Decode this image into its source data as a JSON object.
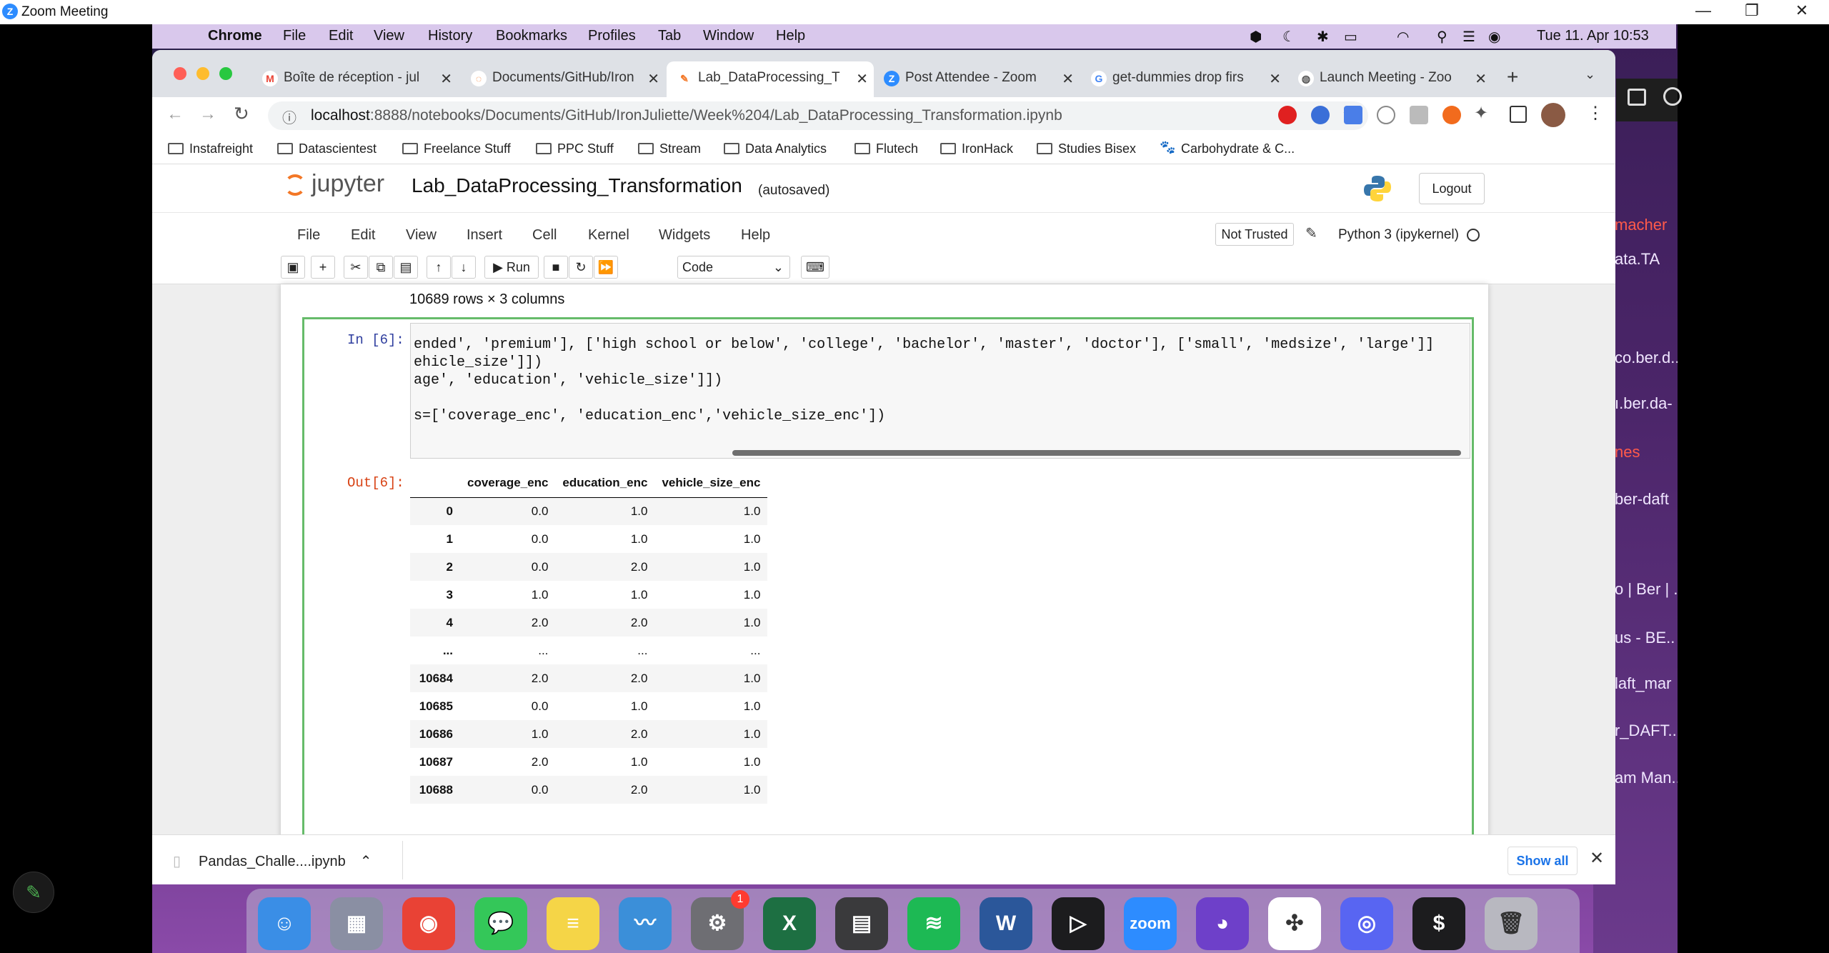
{
  "zoom": {
    "title": "Zoom Meeting",
    "logo": "Z",
    "minimize": "—",
    "restore": "❐",
    "close": "✕"
  },
  "menubar": {
    "items": [
      "Chrome",
      "File",
      "Edit",
      "View",
      "History",
      "Bookmarks",
      "Profiles",
      "Tab",
      "Window",
      "Help"
    ],
    "datetime": "Tue 11. Apr  10:53"
  },
  "tabs": [
    {
      "label": "Boîte de réception - jul",
      "icon": "M"
    },
    {
      "label": "Documents/GitHub/Iron",
      "icon": "◌"
    },
    {
      "label": "Lab_DataProcessing_T",
      "icon": "✎"
    },
    {
      "label": "Post Attendee - Zoom",
      "icon": "Z"
    },
    {
      "label": "get-dummies drop firs",
      "icon": "G"
    },
    {
      "label": "Launch Meeting - Zoo",
      "icon": "◍"
    }
  ],
  "address": {
    "host": "localhost",
    "path": ":8888/notebooks/Documents/GitHub/IronJuliette/Week%204/Lab_DataProcessing_Transformation.ipynb"
  },
  "bookmarks": [
    "Instafreight",
    "Datascientest",
    "Freelance Stuff",
    "PPC Stuff",
    "Stream",
    "Data Analytics",
    "Flutech",
    "IronHack",
    "Studies Bisex",
    "Carbohydrate & C..."
  ],
  "jupyter": {
    "logo_text": "jupyter",
    "notebook_name": "Lab_DataProcessing_Transformation",
    "autosave": "(autosaved)",
    "logout": "Logout",
    "menu": [
      "File",
      "Edit",
      "View",
      "Insert",
      "Cell",
      "Kernel",
      "Widgets",
      "Help"
    ],
    "not_trusted": "Not Trusted",
    "kernel": "Python 3 (ipykernel)",
    "run_label": "Run",
    "cell_type": "Code"
  },
  "notebook": {
    "rows_info": "10689 rows × 3 columns",
    "in_prompt": "In [6]:",
    "out_prompt": "Out[6]:",
    "code_lines": [
      "ended', 'premium'], ['high school or below', 'college', 'bachelor', 'master', 'doctor'], ['small', 'medsize', 'large']]",
      "ehicle_size']])",
      "age', 'education', 'vehicle_size']])",
      "",
      "s=['coverage_enc', 'education_enc','vehicle_size_enc'])"
    ],
    "table": {
      "columns": [
        "coverage_enc",
        "education_enc",
        "vehicle_size_enc"
      ],
      "rows": [
        {
          "index": "0",
          "values": [
            "0.0",
            "1.0",
            "1.0"
          ]
        },
        {
          "index": "1",
          "values": [
            "0.0",
            "1.0",
            "1.0"
          ]
        },
        {
          "index": "2",
          "values": [
            "0.0",
            "2.0",
            "1.0"
          ]
        },
        {
          "index": "3",
          "values": [
            "1.0",
            "1.0",
            "1.0"
          ]
        },
        {
          "index": "4",
          "values": [
            "2.0",
            "2.0",
            "1.0"
          ]
        },
        {
          "index": "...",
          "values": [
            "...",
            "...",
            "..."
          ]
        },
        {
          "index": "10684",
          "values": [
            "2.0",
            "2.0",
            "1.0"
          ]
        },
        {
          "index": "10685",
          "values": [
            "0.0",
            "1.0",
            "1.0"
          ]
        },
        {
          "index": "10686",
          "values": [
            "1.0",
            "2.0",
            "1.0"
          ]
        },
        {
          "index": "10687",
          "values": [
            "2.0",
            "1.0",
            "1.0"
          ]
        },
        {
          "index": "10688",
          "values": [
            "0.0",
            "2.0",
            "1.0"
          ]
        }
      ]
    }
  },
  "download": {
    "file": "Pandas_Challe....ipynb",
    "show_all": "Show all"
  },
  "desktop_side": {
    "items": [
      {
        "text": "macher",
        "red": true
      },
      {
        "text": "ata.TA",
        "red": false
      },
      {
        "text": "co.ber.d..",
        "red": false
      },
      {
        "text": "ı.ber.da-",
        "red": false
      },
      {
        "text": "nes",
        "red": true
      },
      {
        "text": "ber-daft",
        "red": false
      },
      {
        "text": "o | Ber | ..",
        "red": false
      },
      {
        "text": "us - BE..",
        "red": false
      },
      {
        "text": "laft_mar",
        "red": false
      },
      {
        "text": "r_DAFT..",
        "red": false
      },
      {
        "text": "am Man..",
        "red": false
      }
    ]
  },
  "dock": {
    "apps": [
      {
        "name": "finder",
        "glyph": "☺",
        "color": "#3a8ee6"
      },
      {
        "name": "launchpad",
        "glyph": "▦",
        "color": "#8a8fa3"
      },
      {
        "name": "chrome",
        "glyph": "◉",
        "color": "#e94235"
      },
      {
        "name": "messages",
        "glyph": "💬",
        "color": "#34c759"
      },
      {
        "name": "notes",
        "glyph": "≡",
        "color": "#f5d547"
      },
      {
        "name": "mustache-app",
        "glyph": "〰",
        "color": "#3b8fd9"
      },
      {
        "name": "system-settings",
        "glyph": "⚙",
        "color": "#6e6e73"
      },
      {
        "name": "excel",
        "glyph": "X",
        "color": "#1d6f42"
      },
      {
        "name": "calculator",
        "glyph": "▤",
        "color": "#3a3a3c"
      },
      {
        "name": "spotify",
        "glyph": "≋",
        "color": "#1db954"
      },
      {
        "name": "word",
        "glyph": "W",
        "color": "#2b579a"
      },
      {
        "name": "cursor-app",
        "glyph": "▷",
        "color": "#1c1c1e"
      },
      {
        "name": "zoom",
        "glyph": "zoom",
        "color": "#2d8cff"
      },
      {
        "name": "github-desktop",
        "glyph": "◕",
        "color": "#6e40c9"
      },
      {
        "name": "slack",
        "glyph": "✣",
        "color": "#ffffff"
      },
      {
        "name": "discord",
        "glyph": "◎",
        "color": "#5865f2"
      },
      {
        "name": "terminal",
        "glyph": "$",
        "color": "#1c1c1e"
      },
      {
        "name": "trash",
        "glyph": "🗑",
        "color": "#b8b8c0"
      }
    ],
    "settings_badge": "1"
  }
}
